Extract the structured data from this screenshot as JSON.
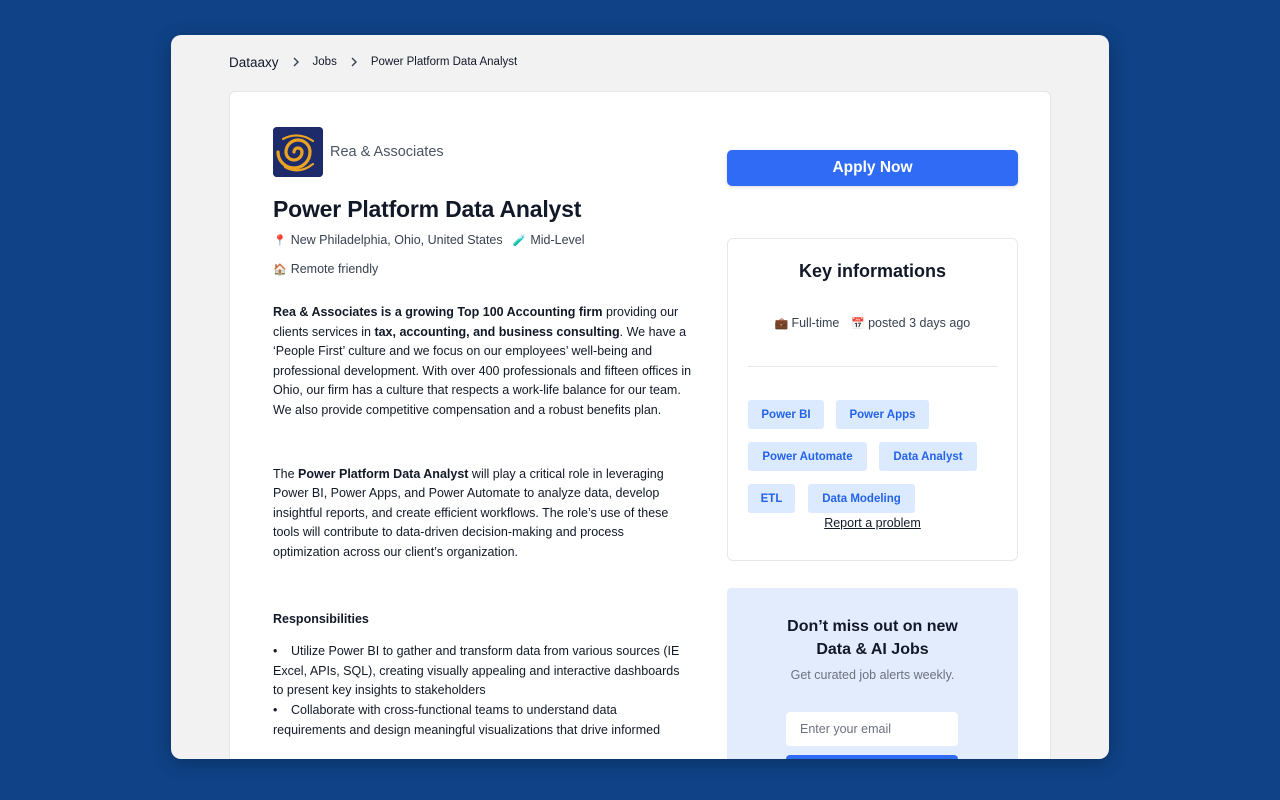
{
  "breadcrumb": {
    "items": [
      "Dataaxy",
      "Jobs",
      "Power Platform Data Analyst"
    ]
  },
  "company": {
    "name": "Rea & Associates",
    "logo_icon": "swirl-logo"
  },
  "job": {
    "title": "Power Platform Data Analyst",
    "location_emoji": "📍",
    "location": "New Philadelphia, Ohio, United States",
    "level_emoji": "🧪",
    "level": "Mid-Level",
    "remote_emoji": "🏠",
    "remote": "Remote friendly"
  },
  "description": {
    "p1_b1": "Rea & Associates is a growing Top 100 Accounting firm",
    "p1_t1": " providing our clients services in ",
    "p1_b2": "tax, accounting, and business consulting",
    "p1_t2": ". We have a ‘People First’ culture and we focus on our employees’ well-being and professional development. With over 400 professionals and fifteen offices in Ohio, our firm has a culture that respects a work-life balance for our team. We also provide competitive compensation and a robust benefits plan.",
    "p2_t1": "The ",
    "p2_b1": "Power Platform Data Analyst",
    "p2_t2": " will play a critical role in leveraging Power BI, Power Apps, and Power Automate to analyze data, develop insightful reports, and create efficient workflows. The role’s use of these tools will contribute to data-driven decision-making and process optimization across our client’s organization.",
    "responsibilities_title": "Responsibilities",
    "bullet_char": "•",
    "bullets": [
      "Utilize Power BI to gather and transform data from various sources (IE Excel, APIs, SQL), creating visually appealing and interactive dashboards to present key insights to stakeholders",
      "Collaborate with cross-functional teams to understand data requirements and design meaningful visualizations that drive informed"
    ]
  },
  "sidebar": {
    "apply_label": "Apply Now",
    "key_info_title": "Key informations",
    "employment_emoji": "💼",
    "employment": "Full-time",
    "posted_emoji": "📅",
    "posted": "posted 3 days ago",
    "tags": [
      "Power BI",
      "Power Apps",
      "Power Automate",
      "Data Analyst",
      "ETL",
      "Data Modeling"
    ],
    "report_label": "Report a problem"
  },
  "newsletter": {
    "title_line1": "Don’t miss out on new",
    "title_line2": "Data & AI Jobs",
    "subtitle": "Get curated job alerts weekly.",
    "email_placeholder": "Enter your email"
  },
  "colors": {
    "background": "#0f4286",
    "accent": "#2f6bf5",
    "tag_bg": "#dbeafe",
    "tag_text": "#2563eb",
    "newsletter_bg": "#e3ecfc"
  }
}
